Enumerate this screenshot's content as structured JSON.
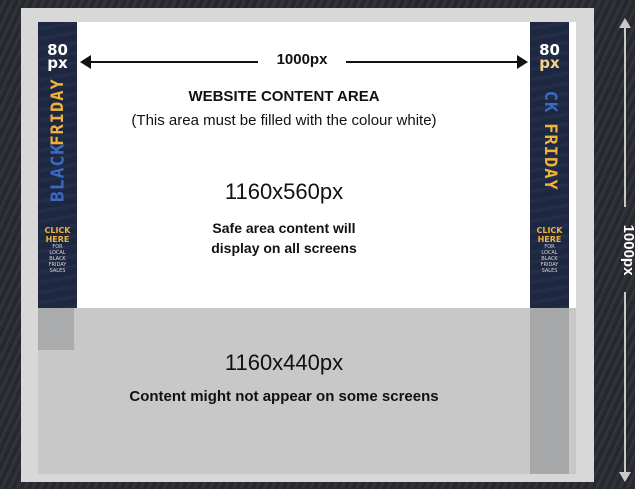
{
  "width_dimension": "1000px",
  "height_dimension": "1000px",
  "content_area": {
    "title": "WEBSITE CONTENT AREA",
    "note": "(This area must be filled with the colour white)"
  },
  "safe_area": {
    "dimension": "1160x560px",
    "line1": "Safe area content will",
    "line2": "display on all screens"
  },
  "unsafe_area": {
    "dimension": "1160x440px",
    "text": "Content might not appear on some screens"
  },
  "skyscraper_left": {
    "badge_num": "80",
    "badge_unit": "px",
    "word_top": "FRIDAY",
    "word_bottom": "BLACK",
    "cta_main": [
      "CLICK",
      "HERE"
    ],
    "cta_sub": [
      "FOR",
      "LOCAL",
      "BLACK",
      "FRIDAY",
      "SALES"
    ]
  },
  "skyscraper_right": {
    "badge_num": "80",
    "badge_unit": "px",
    "word_top": "CK",
    "word_bottom": "FRIDAY",
    "cta_main": [
      "CLICK",
      "HERE"
    ],
    "cta_sub": [
      "FOR",
      "LOCAL",
      "BLACK",
      "FRIDAY",
      "SALES"
    ]
  },
  "colors": {
    "background": "#2b2d34",
    "frame": "#d8d8d8",
    "safe_area": "#ffffff",
    "unsafe_area": "#c8c8c9",
    "skyscraper": "#1f2a44",
    "accent_orange": "#f0b23a"
  }
}
